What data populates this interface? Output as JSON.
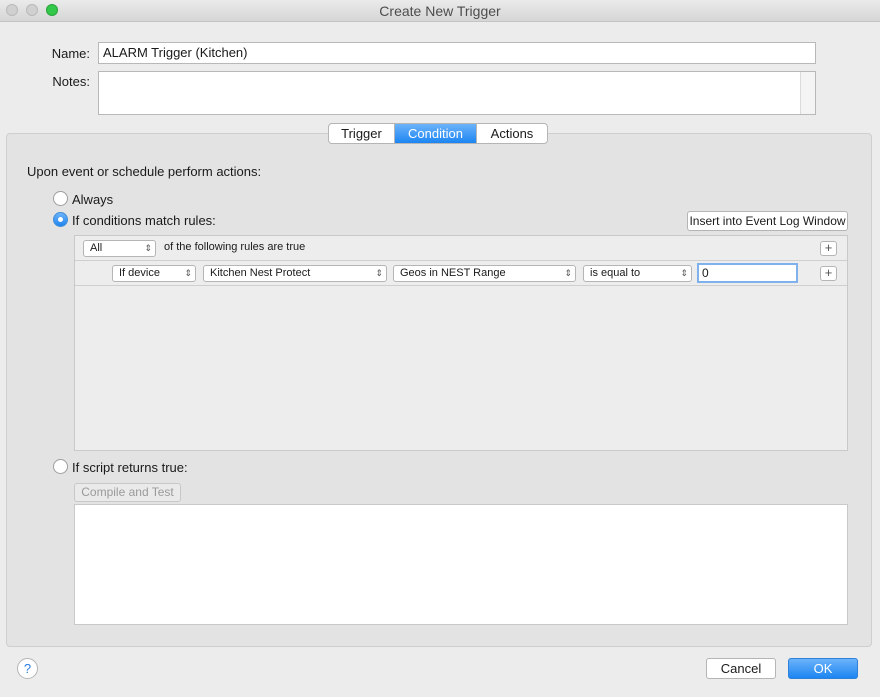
{
  "window": {
    "title": "Create New Trigger"
  },
  "form": {
    "name_label": "Name:",
    "name_value": "ALARM Trigger (Kitchen)",
    "notes_label": "Notes:",
    "notes_value": ""
  },
  "tabs": [
    {
      "label": "Trigger",
      "active": false
    },
    {
      "label": "Condition",
      "active": true
    },
    {
      "label": "Actions",
      "active": false
    }
  ],
  "condition": {
    "heading": "Upon event or schedule perform actions:",
    "option_always": "Always",
    "option_rules": "If conditions match rules:",
    "option_script": "If script returns true:",
    "selected": "rules",
    "insert_button": "Insert into Event Log Window",
    "match_select": "All",
    "match_suffix": "of the following rules are true",
    "rule": {
      "type": "If device",
      "device": "Kitchen Nest Protect",
      "state": "Geos in NEST Range",
      "operator": "is equal to",
      "value": "0"
    },
    "compile_button": "Compile and Test"
  },
  "footer": {
    "help": "?",
    "cancel": "Cancel",
    "ok": "OK"
  }
}
